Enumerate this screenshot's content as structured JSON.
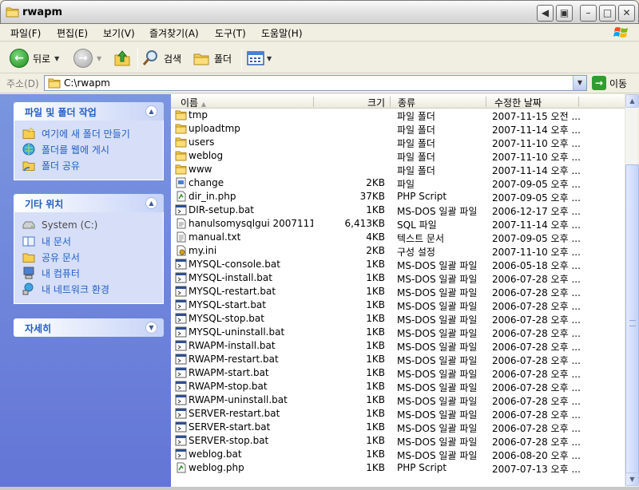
{
  "window": {
    "title": "rwapm"
  },
  "menu": [
    "파일(F)",
    "편집(E)",
    "보기(V)",
    "즐겨찾기(A)",
    "도구(T)",
    "도움말(H)"
  ],
  "toolbar": {
    "back_label": "뒤로",
    "search_label": "검색",
    "folders_label": "폴더"
  },
  "address": {
    "label": "주소(D)",
    "value": "C:\\rwapm",
    "go_label": "이동"
  },
  "taskpane": {
    "file_tasks": {
      "title": "파일 및 폴더 작업",
      "items": [
        "여기에 새 폴더 만들기",
        "폴더를 웹에 게시",
        "폴더 공유"
      ]
    },
    "other_places": {
      "title": "기타 위치",
      "items": [
        "System (C:)",
        "내 문서",
        "공유 문서",
        "내 컴퓨터",
        "내 네트워크 환경"
      ]
    },
    "details": {
      "title": "자세히"
    }
  },
  "columns": {
    "name": "이름",
    "size": "크기",
    "type": "종류",
    "modified": "수정한 날짜"
  },
  "files": [
    {
      "name": "tmp",
      "size": "",
      "type": "파일 폴더",
      "date": "2007-11-15 오전 ...",
      "icon": "folder"
    },
    {
      "name": "uploadtmp",
      "size": "",
      "type": "파일 폴더",
      "date": "2007-11-14 오후 ...",
      "icon": "folder"
    },
    {
      "name": "users",
      "size": "",
      "type": "파일 폴더",
      "date": "2007-11-10 오후 ...",
      "icon": "folder"
    },
    {
      "name": "weblog",
      "size": "",
      "type": "파일 폴더",
      "date": "2007-11-10 오후 ...",
      "icon": "folder"
    },
    {
      "name": "www",
      "size": "",
      "type": "파일 폴더",
      "date": "2007-11-14 오후 ...",
      "icon": "folder"
    },
    {
      "name": "change",
      "size": "2KB",
      "type": "파일",
      "date": "2007-09-05 오후 ...",
      "icon": "file"
    },
    {
      "name": "dir_in.php",
      "size": "37KB",
      "type": "PHP Script",
      "date": "2007-09-05 오후 ...",
      "icon": "php"
    },
    {
      "name": "DIR-setup.bat",
      "size": "1KB",
      "type": "MS-DOS 일괄 파일",
      "date": "2006-12-17 오후 ...",
      "icon": "bat"
    },
    {
      "name": "hanulsomysqlgui 2007111...",
      "size": "6,413KB",
      "type": "SQL 파일",
      "date": "2007-11-14 오후 ...",
      "icon": "sql"
    },
    {
      "name": "manual.txt",
      "size": "4KB",
      "type": "텍스트 문서",
      "date": "2007-09-05 오후 ...",
      "icon": "txt"
    },
    {
      "name": "my.ini",
      "size": "2KB",
      "type": "구성 설정",
      "date": "2007-11-10 오후 ...",
      "icon": "ini"
    },
    {
      "name": "MYSQL-console.bat",
      "size": "1KB",
      "type": "MS-DOS 일괄 파일",
      "date": "2006-05-18 오후 ...",
      "icon": "bat"
    },
    {
      "name": "MYSQL-install.bat",
      "size": "1KB",
      "type": "MS-DOS 일괄 파일",
      "date": "2006-07-28 오후 ...",
      "icon": "bat"
    },
    {
      "name": "MYSQL-restart.bat",
      "size": "1KB",
      "type": "MS-DOS 일괄 파일",
      "date": "2006-07-28 오후 ...",
      "icon": "bat"
    },
    {
      "name": "MYSQL-start.bat",
      "size": "1KB",
      "type": "MS-DOS 일괄 파일",
      "date": "2006-07-28 오후 ...",
      "icon": "bat"
    },
    {
      "name": "MYSQL-stop.bat",
      "size": "1KB",
      "type": "MS-DOS 일괄 파일",
      "date": "2006-07-28 오후 ...",
      "icon": "bat"
    },
    {
      "name": "MYSQL-uninstall.bat",
      "size": "1KB",
      "type": "MS-DOS 일괄 파일",
      "date": "2006-07-28 오후 ...",
      "icon": "bat"
    },
    {
      "name": "RWAPM-install.bat",
      "size": "1KB",
      "type": "MS-DOS 일괄 파일",
      "date": "2006-07-28 오후 ...",
      "icon": "bat"
    },
    {
      "name": "RWAPM-restart.bat",
      "size": "1KB",
      "type": "MS-DOS 일괄 파일",
      "date": "2006-07-28 오후 ...",
      "icon": "bat"
    },
    {
      "name": "RWAPM-start.bat",
      "size": "1KB",
      "type": "MS-DOS 일괄 파일",
      "date": "2006-07-28 오후 ...",
      "icon": "bat"
    },
    {
      "name": "RWAPM-stop.bat",
      "size": "1KB",
      "type": "MS-DOS 일괄 파일",
      "date": "2006-07-28 오후 ...",
      "icon": "bat"
    },
    {
      "name": "RWAPM-uninstall.bat",
      "size": "1KB",
      "type": "MS-DOS 일괄 파일",
      "date": "2006-07-28 오후 ...",
      "icon": "bat"
    },
    {
      "name": "SERVER-restart.bat",
      "size": "1KB",
      "type": "MS-DOS 일괄 파일",
      "date": "2006-07-28 오후 ...",
      "icon": "bat"
    },
    {
      "name": "SERVER-start.bat",
      "size": "1KB",
      "type": "MS-DOS 일괄 파일",
      "date": "2006-07-28 오후 ...",
      "icon": "bat"
    },
    {
      "name": "SERVER-stop.bat",
      "size": "1KB",
      "type": "MS-DOS 일괄 파일",
      "date": "2006-07-28 오후 ...",
      "icon": "bat"
    },
    {
      "name": "weblog.bat",
      "size": "1KB",
      "type": "MS-DOS 일괄 파일",
      "date": "2006-08-20 오후 ...",
      "icon": "bat"
    },
    {
      "name": "weblog.php",
      "size": "1KB",
      "type": "PHP Script",
      "date": "2007-07-13 오후 ...",
      "icon": "php"
    }
  ]
}
